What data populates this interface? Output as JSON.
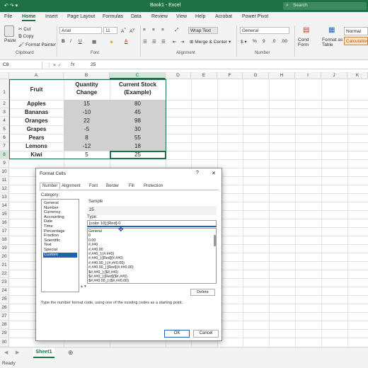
{
  "titlebar": {
    "quickaccess": "↶  ↷  ▾",
    "title": "Book1 - Excel",
    "search": "Search"
  },
  "tabs": [
    "File",
    "Home",
    "Insert",
    "Page Layout",
    "Formulas",
    "Data",
    "Review",
    "View",
    "Help",
    "Acrobat",
    "Power Pivot"
  ],
  "ribbon": {
    "paste": "Paste",
    "cut": "Cut",
    "copy": "Copy",
    "format_painter": "Format Painter",
    "clipboard": "Clipboard",
    "font_name": "Arial",
    "font_size": "11",
    "font": "Font",
    "wrap_text": "Wrap Text",
    "merge_center": "Merge & Center",
    "alignment": "Alignment",
    "number_format": "General",
    "number": "Number",
    "cond_fmt": "Cond Form",
    "format_table": "Format as Table",
    "style_normal": "Normal",
    "style_calc": "Calculation"
  },
  "formula_bar": {
    "name_box": "C8",
    "fx": "fx",
    "value": "25"
  },
  "columns": [
    "A",
    "B",
    "C",
    "D",
    "E",
    "F",
    "G",
    "H",
    "I",
    "J",
    "K"
  ],
  "rows": [
    "1",
    "2",
    "3",
    "4",
    "5",
    "6",
    "7",
    "8",
    "9",
    "10",
    "11",
    "12",
    "13",
    "14",
    "15",
    "16",
    "17",
    "18",
    "19",
    "20",
    "21",
    "22",
    "23",
    "24",
    "25",
    "26",
    "27",
    "28",
    "29",
    "30",
    "31",
    "32"
  ],
  "table": {
    "headers": [
      "Fruit",
      "Quantity Change",
      "Current Stock (Example)"
    ],
    "header_lines": [
      [
        "Fruit"
      ],
      [
        "Quantity",
        "Change"
      ],
      [
        "Current Stock",
        "(Example)"
      ]
    ],
    "rows": [
      [
        "Apples",
        "15",
        "80"
      ],
      [
        "Bananas",
        "-10",
        "45"
      ],
      [
        "Oranges",
        "22",
        "98"
      ],
      [
        "Grapes",
        "-5",
        "30"
      ],
      [
        "Pears",
        "8",
        "55"
      ],
      [
        "Lemons",
        "-12",
        "18"
      ],
      [
        "Kiwi",
        "5",
        "25"
      ]
    ]
  },
  "sheet": {
    "tab": "Sheet1",
    "add": "⊕",
    "status": "Ready"
  },
  "dialog": {
    "title": "Format Cells",
    "help": "?",
    "close": "✕",
    "tabs": [
      "Number",
      "Alignment",
      "Font",
      "Border",
      "Fill",
      "Protection"
    ],
    "category_label": "Category:",
    "categories": [
      "General",
      "Number",
      "Currency",
      "Accounting",
      "Date",
      "Time",
      "Percentage",
      "Fraction",
      "Scientific",
      "Text",
      "Special",
      "Custom"
    ],
    "selected_category": "Custom",
    "sample_label": "Sample",
    "sample_value": "25",
    "type_label": "Type:",
    "type_value": "[color 10];[Red]-0",
    "formats": [
      "General",
      "0",
      "0.00",
      "#,##0",
      "#,##0.00",
      "#,##0_);(#,##0)",
      "#,##0_);[Red](#,##0)",
      "#,##0.00_);(#,##0.00)",
      "#,##0.00_);[Red](#,##0.00)",
      "$#,##0_);($#,##0)",
      "$#,##0_);[Red]($#,##0)",
      "$#,##0.00_);($#,##0.00)"
    ],
    "delete": "Delete",
    "help_text": "Type the number format code, using one of the existing codes as a starting point.",
    "ok": "OK",
    "cancel": "Cancel"
  },
  "colors": {
    "accent": "#1e7145",
    "selection": "#1a64b4",
    "shaded_cells": "#d0d0d0"
  }
}
